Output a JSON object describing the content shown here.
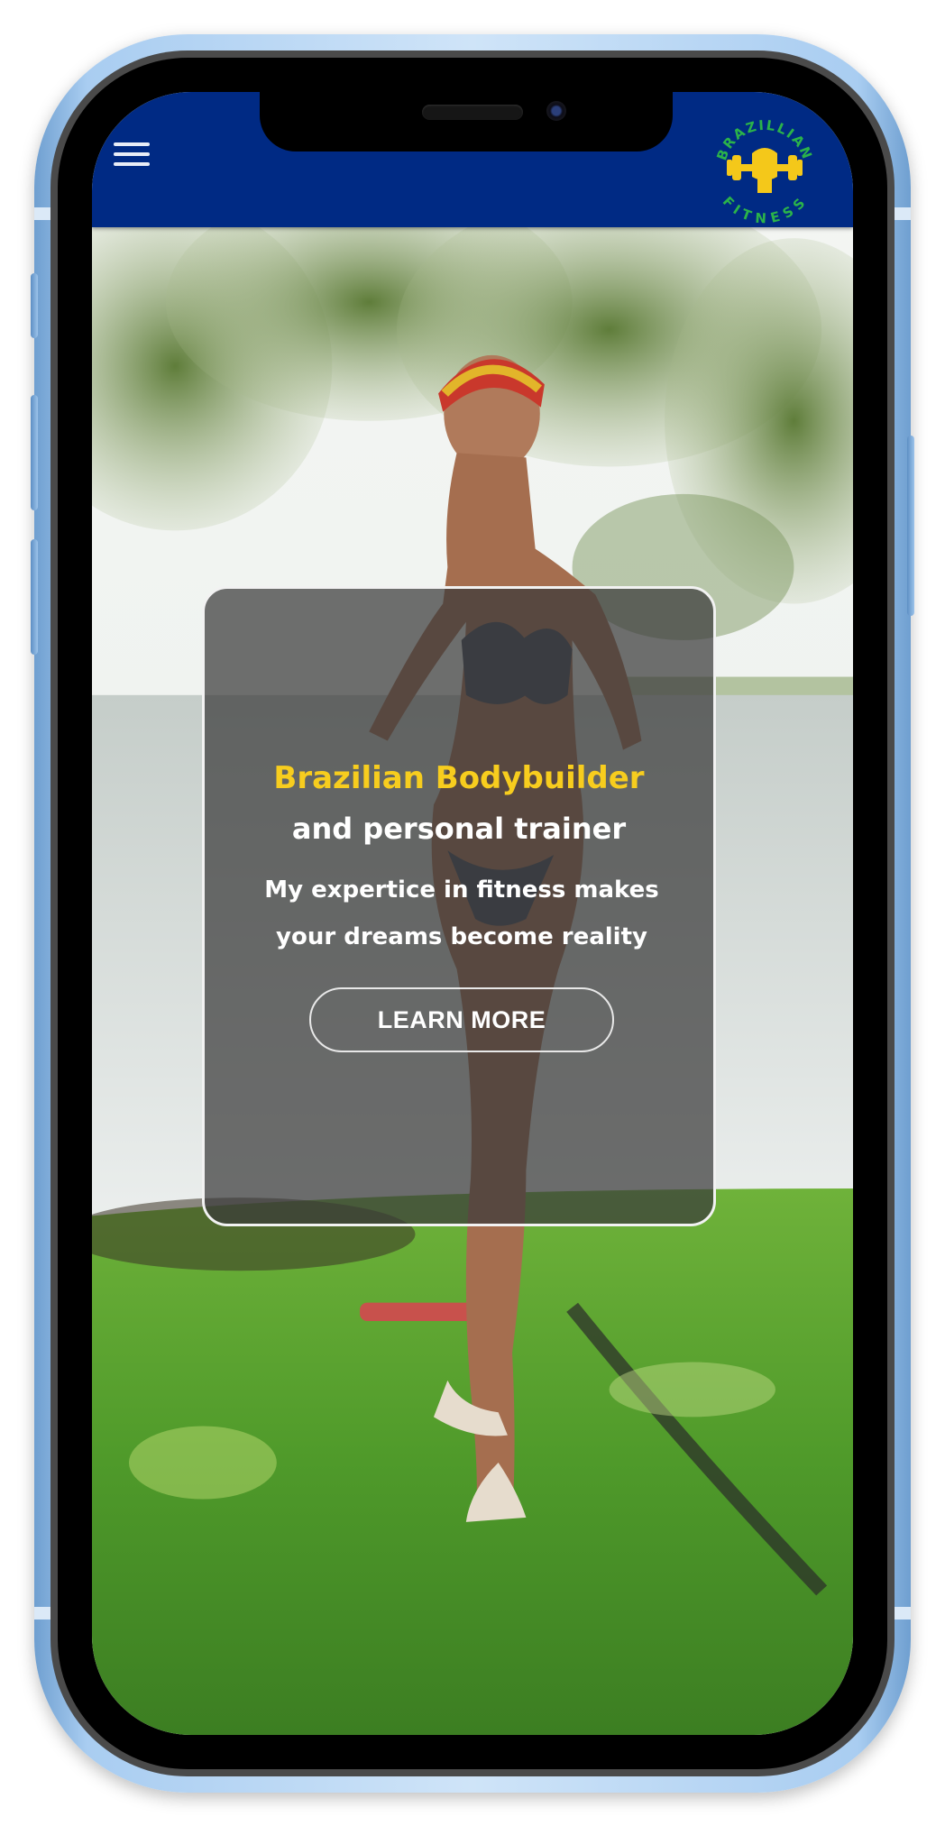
{
  "header": {
    "menu_icon": "hamburger-menu-icon",
    "background_color": "#002a84",
    "logo": {
      "text_top": "BRAZILLIAN",
      "text_bottom": "FITNESS",
      "icon": "fist-dumbbell-icon",
      "color": "#f4c81a"
    }
  },
  "hero": {
    "title": "Brazilian Bodybuilder",
    "subtitle": "and personal trainer",
    "description": "My expertice in fitness makes your dreams become reality",
    "cta_label": "LEARN MORE",
    "title_color": "#f7cd1e"
  },
  "device": {
    "frame_color": "#a9cdf1"
  }
}
